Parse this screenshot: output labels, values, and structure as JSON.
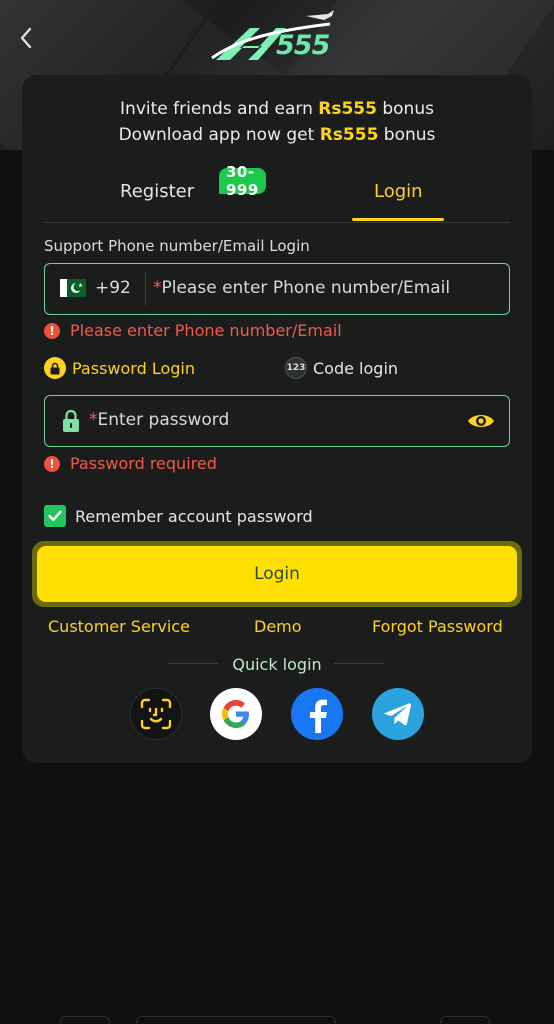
{
  "header": {
    "back_icon": "chevron-left-icon",
    "logo_text": "555"
  },
  "promo": {
    "line1_prefix": "Invite friends and earn ",
    "line1_amount": "Rs555",
    "line1_suffix": " bonus",
    "line2_prefix": "Download app now get ",
    "line2_amount": "Rs555",
    "line2_suffix": " bonus"
  },
  "tabs": {
    "register_label": "Register",
    "register_badge": "30-999",
    "login_label": "Login",
    "active": "Login"
  },
  "form": {
    "support_label": "Support Phone number/Email Login",
    "country_code": "+92",
    "phone_placeholder_star": "*",
    "phone_placeholder": "Please enter Phone number/Email",
    "phone_error": "Please enter Phone number/Email",
    "method_password": "Password Login",
    "method_code": "Code login",
    "method_code_icon_text": "123",
    "password_placeholder_star": "*",
    "password_placeholder": "Enter password",
    "password_error": "Password required",
    "remember_label": "Remember account password",
    "remember_checked": true,
    "login_button": "Login"
  },
  "links": {
    "customer_service": "Customer Service",
    "demo": "Demo",
    "forgot_password": "Forgot Password"
  },
  "quick_login": {
    "label": "Quick login",
    "methods": [
      "face-id-icon",
      "google-icon",
      "facebook-icon",
      "telegram-icon"
    ]
  },
  "colors": {
    "accent": "#ffd21f",
    "button": "#ffe000",
    "error": "#f05a4a",
    "field_border": "#6fd39a",
    "badge": "#1cc94b"
  }
}
